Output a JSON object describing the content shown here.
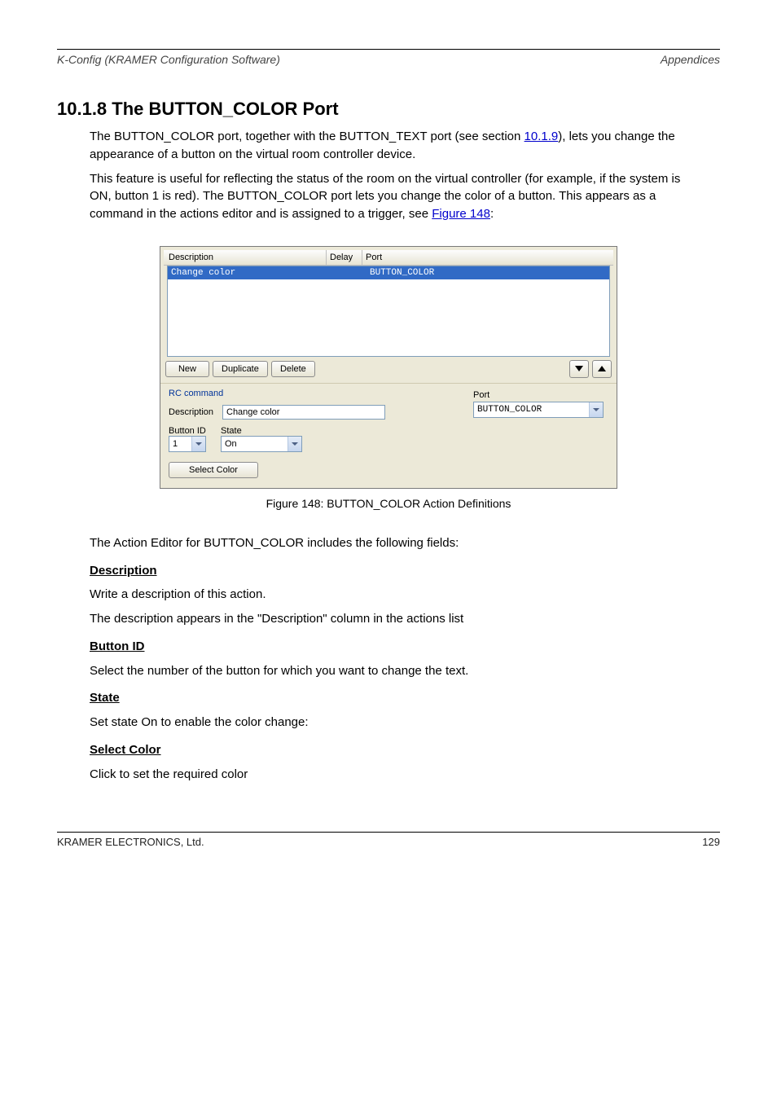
{
  "header": {
    "doc": "K-Config (KRAMER Configuration Software)",
    "section": "Appendices"
  },
  "section_number": "10.1.8 The BUTTON_COLOR Port",
  "intro_p1_a": "The BUTTON_COLOR port, together with the ",
  "intro_p1_link": "BUTTON_TEXT port",
  "intro_p1_b": " (see section ",
  "intro_p1_sec_link": "10.1.9",
  "intro_p1_c": "), lets you change the appearance of a button on the virtual room controller device.",
  "intro_p2_a": "This feature is useful for reflecting the status of the room on the virtual controller (for example, if the system is ON, button 1 is red). The BUTTON_COLOR port lets you change the color of a button. This appears as a command in the actions editor and is assigned to a trigger, see ",
  "intro_p2_link": "Figure 148",
  "intro_p2_b": ":",
  "figure": {
    "columns": {
      "description": "Description",
      "delay": "Delay",
      "port": "Port"
    },
    "row": {
      "description": "Change color",
      "delay": "",
      "port": "BUTTON_COLOR"
    },
    "buttons": {
      "new": "New",
      "duplicate": "Duplicate",
      "delete": "Delete"
    },
    "group_legend": "RC command",
    "description_label": "Description",
    "description_value": "Change color",
    "port_label": "Port",
    "port_value": "BUTTON_COLOR",
    "button_id_label": "Button ID",
    "button_id_value": "1",
    "state_label": "State",
    "state_value": "On",
    "select_color": "Select Color"
  },
  "caption": "Figure 148: BUTTON_COLOR Action Definitions",
  "fields_intro": "The Action Editor for BUTTON_COLOR includes the following fields:",
  "fields": [
    {
      "name": "Description",
      "text1": "Write a description of this action.",
      "text2": "The description appears in the \"Description\" column in the actions list"
    },
    {
      "name": "Button ID",
      "text1": "Select the number of the button for which you want to change the text."
    },
    {
      "name": "State",
      "text1": "Set state On to enable the color change:"
    },
    {
      "name": "Select Color",
      "text1": "Click to set the required color"
    }
  ],
  "footer": {
    "left": "KRAMER ELECTRONICS, Ltd.",
    "right": "129"
  }
}
